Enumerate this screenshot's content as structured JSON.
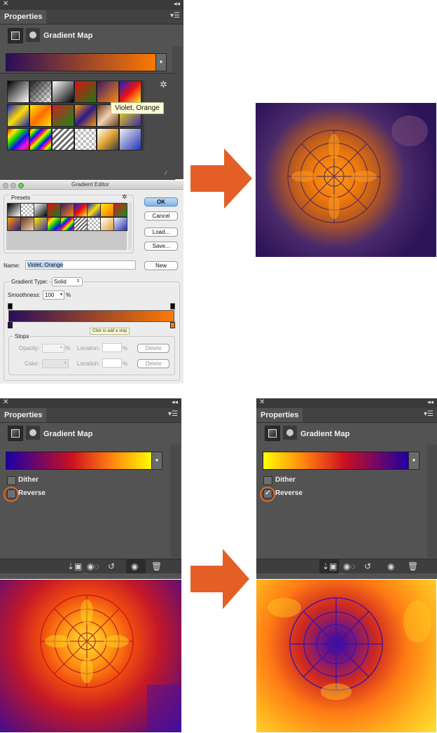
{
  "top_panel": {
    "tab": "Properties",
    "title": "Gradient Map",
    "tooltip": "Violet, Orange"
  },
  "gradient_editor": {
    "window_title": "Gradient Editor",
    "presets_label": "Presets",
    "ok": "OK",
    "cancel": "Cancel",
    "load": "Load...",
    "save": "Save...",
    "name_label": "Name:",
    "name_value": "Violet, Orange",
    "new": "New",
    "gradient_type_label": "Gradient Type:",
    "gradient_type_value": "Solid",
    "smoothness_label": "Smoothness:",
    "smoothness_value": "100",
    "smoothness_unit": "%",
    "add_stop_tip": "Click to add a stop",
    "stops_label": "Stops",
    "opacity_label": "Opacity:",
    "opacity_unit": "%",
    "location_label_1": "Location:",
    "location_unit_1": "%",
    "delete_1": "Delete",
    "color_label": "Color:",
    "location_label_2": "Location:",
    "location_unit_2": "%",
    "delete_2": "Delete"
  },
  "left_panel": {
    "tab": "Properties",
    "title": "Gradient Map",
    "dither": "Dither",
    "reverse": "Reverse",
    "reverse_checked": false
  },
  "right_panel": {
    "tab": "Properties",
    "title": "Gradient Map",
    "dither": "Dither",
    "reverse": "Reverse",
    "reverse_checked": true
  },
  "colors": {
    "accent_arrow": "#e35f26",
    "violet": "#2a0d5a",
    "orange": "#ff7a00"
  }
}
